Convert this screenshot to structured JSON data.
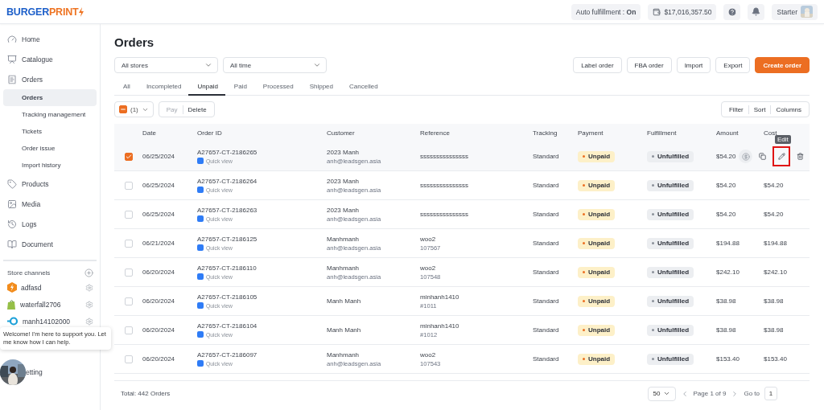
{
  "header": {
    "logo": {
      "first": "BURGER",
      "second": "PRINT"
    },
    "auto_fulfillment": "Auto fulfillment : **On**",
    "balance": "$17,016,357.50",
    "plan": "Starter"
  },
  "sidebar": {
    "items": [
      {
        "label": "Home",
        "kind": "home",
        "selected": false
      },
      {
        "label": "Catalogue",
        "kind": "catalogue",
        "selected": false
      },
      {
        "label": "Orders",
        "kind": "orders",
        "selected": false,
        "children": [
          {
            "label": "Orders",
            "selected": true
          },
          {
            "label": "Tracking management",
            "selected": false
          },
          {
            "label": "Tickets",
            "selected": false
          },
          {
            "label": "Order issue",
            "selected": false
          },
          {
            "label": "Import history",
            "selected": false
          }
        ]
      },
      {
        "label": "Products",
        "kind": "products",
        "selected": false
      },
      {
        "label": "Media",
        "kind": "media",
        "selected": false
      },
      {
        "label": "Logs",
        "kind": "logs",
        "selected": false
      },
      {
        "label": "Document",
        "kind": "document",
        "selected": false
      }
    ],
    "store_channels": {
      "title": "Store channels",
      "items": [
        {
          "name": "adfasd",
          "kind": "burgerprint"
        },
        {
          "name": "waterfall2706",
          "kind": "shopify"
        },
        {
          "name": "manh14102000",
          "kind": "woo"
        }
      ]
    },
    "setting": "etting",
    "chat_message": "Welcome! I'm here to support you. Let me know how I can help."
  },
  "page": {
    "title": "Orders",
    "filters": [
      {
        "value": "All stores"
      },
      {
        "value": "All time"
      }
    ],
    "actions": [
      {
        "label": "Label order",
        "kind": "outline"
      },
      {
        "label": "FBA order",
        "kind": "outline"
      },
      {
        "label": "Import",
        "kind": "outline"
      },
      {
        "label": "Export",
        "kind": "outline"
      },
      {
        "label": "Create order",
        "kind": "primary"
      }
    ],
    "tabs": [
      {
        "label": "All",
        "selected": false
      },
      {
        "label": "Incompleted",
        "selected": false
      },
      {
        "label": "Unpaid",
        "selected": true
      },
      {
        "label": "Paid",
        "selected": false
      },
      {
        "label": "Processed",
        "selected": false
      },
      {
        "label": "Shipped",
        "selected": false
      },
      {
        "label": "Cancelled",
        "selected": false
      }
    ],
    "bulk": {
      "count": "(1)",
      "buttons": [
        {
          "label": "Pay",
          "disabled": true
        },
        {
          "label": "Delete",
          "disabled": false
        }
      ]
    },
    "view_controls": [
      "Filter",
      "Sort",
      "Columns"
    ],
    "table": {
      "columns": [
        "Date",
        "Order ID",
        "Customer",
        "Reference",
        "Tracking",
        "Payment",
        "Fulfillment",
        "Amount",
        "Cost"
      ],
      "edit_tooltip": "Edit",
      "rows": [
        {
          "selected": true,
          "hovered": true,
          "date": "06/25/2024",
          "order_id": "A27657-CT-2186265",
          "quick_view": "Quick view",
          "customer": "2023 Manh",
          "email": "anh@leadsgen.asia",
          "reference": "sssssssssssssss",
          "tracking": "Standard",
          "payment": "Unpaid",
          "fulfillment": "Unfulfilled",
          "amount": "$54.20"
        },
        {
          "selected": false,
          "hovered": false,
          "date": "06/25/2024",
          "order_id": "A27657-CT-2186264",
          "quick_view": "Quick view",
          "customer": "2023 Manh",
          "email": "anh@leadsgen.asia",
          "reference": "sssssssssssssss",
          "tracking": "Standard",
          "payment": "Unpaid",
          "fulfillment": "Unfulfilled",
          "amount": "$54.20",
          "cost": "$54.20"
        },
        {
          "selected": false,
          "hovered": false,
          "date": "06/25/2024",
          "order_id": "A27657-CT-2186263",
          "quick_view": "Quick view",
          "customer": "2023 Manh",
          "email": "anh@leadsgen.asia",
          "reference": "sssssssssssssss",
          "tracking": "Standard",
          "payment": "Unpaid",
          "fulfillment": "Unfulfilled",
          "amount": "$54.20",
          "cost": "$54.20"
        },
        {
          "selected": false,
          "hovered": false,
          "date": "06/21/2024",
          "order_id": "A27657-CT-2186125",
          "quick_view": "Quick view",
          "customer": "Manhmanh",
          "email": "anh@leadsgen.asia",
          "reference": "woo2",
          "reference_id": "107567",
          "tracking": "Standard",
          "payment": "Unpaid",
          "fulfillment": "Unfulfilled",
          "amount": "$194.88",
          "cost": "$194.88"
        },
        {
          "selected": false,
          "hovered": false,
          "date": "06/20/2024",
          "order_id": "A27657-CT-2186110",
          "quick_view": "Quick view",
          "customer": "Manhmanh",
          "email": "anh@leadsgen.asia",
          "reference": "woo2",
          "reference_id": "107548",
          "tracking": "Standard",
          "payment": "Unpaid",
          "fulfillment": "Unfulfilled",
          "amount": "$242.10",
          "cost": "$242.10"
        },
        {
          "selected": false,
          "hovered": false,
          "date": "06/20/2024",
          "order_id": "A27657-CT-2186105",
          "quick_view": "Quick view",
          "customer": "Manh Manh",
          "reference": "minhanh1410",
          "reference_id": "#1011",
          "tracking": "Standard",
          "payment": "Unpaid",
          "fulfillment": "Unfulfilled",
          "amount": "$38.98",
          "cost": "$38.98"
        },
        {
          "selected": false,
          "hovered": false,
          "date": "06/20/2024",
          "order_id": "A27657-CT-2186104",
          "quick_view": "Quick view",
          "customer": "Manh Manh",
          "reference": "minhanh1410",
          "reference_id": "#1012",
          "tracking": "Standard",
          "payment": "Unpaid",
          "fulfillment": "Unfulfilled",
          "amount": "$38.98",
          "cost": "$38.98"
        },
        {
          "selected": false,
          "hovered": false,
          "date": "06/20/2024",
          "order_id": "A27657-CT-2186097",
          "quick_view": "Quick view",
          "customer": "Manhmanh",
          "email": "anh@leadsgen.asia",
          "reference": "woo2",
          "reference_id": "107543",
          "tracking": "Standard",
          "payment": "Unpaid",
          "fulfillment": "Unfulfilled",
          "amount": "$153.40",
          "cost": "$153.40"
        }
      ]
    },
    "footer": {
      "total": "Total: 442 Orders",
      "page_size": "50",
      "page_info": "Page 1 of 9",
      "goto_label": "Go to",
      "goto_value": "1"
    }
  }
}
